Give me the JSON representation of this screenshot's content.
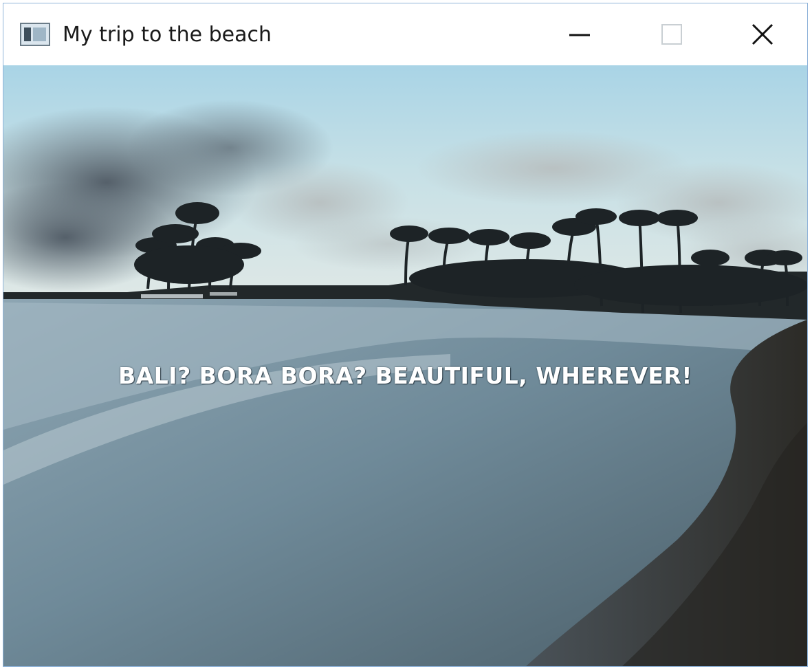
{
  "window": {
    "title": "My trip to the beach",
    "controls": {
      "minimize_icon": "minimize-icon",
      "maximize_icon": "maximize-icon",
      "close_icon": "close-icon"
    }
  },
  "content": {
    "caption": "BALI? BORA BORA? BEAUTIFUL, WHEREVER!",
    "image_subject": "beach-with-palm-trees-at-dusk"
  },
  "colors": {
    "sky_top": "#a9d3e4",
    "sea": "#6d8796",
    "sand_dark": "#2f2e2a",
    "caption_text": "#ffffff"
  }
}
